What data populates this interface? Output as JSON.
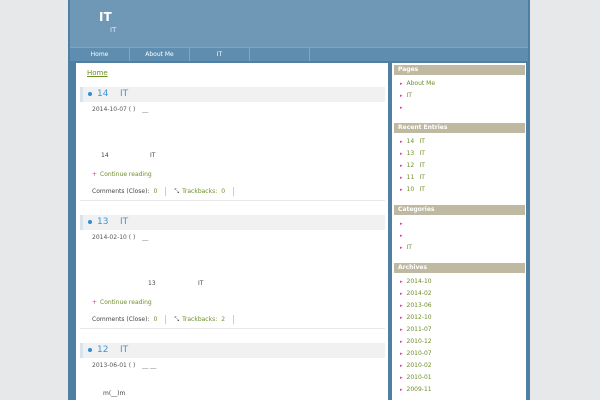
{
  "site": {
    "title": "IT",
    "subtitle": "IT"
  },
  "nav": {
    "items": [
      {
        "label": "Home"
      },
      {
        "label": "About Me"
      },
      {
        "label": "IT"
      },
      {
        "label": ""
      }
    ]
  },
  "breadcrumb": "Home",
  "posts": [
    {
      "num": "14",
      "title": "IT",
      "date": "2014-10-07 ( )",
      "underscore": "__",
      "body_num": "14",
      "body_it": "IT",
      "continue": "Continue reading",
      "comments": "Comments (Close):",
      "comments_count": "0",
      "trackbacks": "Trackbacks:",
      "trackbacks_count": "0"
    },
    {
      "num": "13",
      "title": "IT",
      "date": "2014-02-10 ( )",
      "underscore": "__",
      "body_num": "13",
      "body_it": "IT",
      "continue": "Continue reading",
      "comments": "Comments (Close):",
      "comments_count": "0",
      "trackbacks": "Trackbacks:",
      "trackbacks_count": "2"
    },
    {
      "num": "12",
      "title": "IT",
      "date": "2013-06-01 ( )",
      "underscore": "__ __",
      "body_line": "m(__)m"
    }
  ],
  "sidebar": {
    "pages": {
      "title": "Pages",
      "items": [
        "About Me",
        "IT",
        ""
      ]
    },
    "recent": {
      "title": "Recent Entries",
      "items": [
        {
          "num": "14",
          "label": "IT"
        },
        {
          "num": "13",
          "label": "IT"
        },
        {
          "num": "12",
          "label": "IT"
        },
        {
          "num": "11",
          "label": "IT"
        },
        {
          "num": "10",
          "label": "IT"
        }
      ]
    },
    "categories": {
      "title": "Categories",
      "items": [
        "",
        "",
        "IT"
      ]
    },
    "archives": {
      "title": "Archives",
      "items": [
        "2014-10",
        "2014-02",
        "2013-06",
        "2012-10",
        "2011-07",
        "2010-12",
        "2010-07",
        "2010-02",
        "2010-01",
        "2009-11"
      ]
    }
  }
}
